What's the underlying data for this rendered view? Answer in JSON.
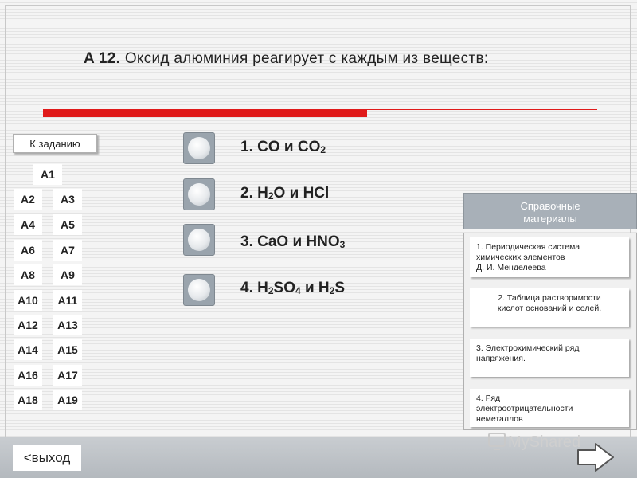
{
  "question": {
    "number": "A 12.",
    "text": "Оксид алюминия реагирует с каждым из веществ:"
  },
  "to_task_label": "К заданию",
  "task_nav": [
    "A1",
    "A2",
    "A3",
    "A4",
    "A5",
    "A6",
    "A7",
    "A8",
    "A9",
    "A10",
    "A11",
    "A12",
    "A13",
    "A14",
    "A15",
    "A16",
    "A17",
    "A18",
    "A19"
  ],
  "answers": [
    {
      "prefix": "1. CO и CO",
      "sub": "2",
      "rest": ""
    },
    {
      "prefix": "2. H",
      "sub": "2",
      "rest": "O и HCl"
    },
    {
      "prefix": "3. CaO и HNO",
      "sub": "3",
      "rest": ""
    },
    {
      "p1": "4. H",
      "s1": "2",
      "p2": "SO",
      "s2": "4",
      "p3": " и H",
      "s3": "2",
      "p4": "S"
    }
  ],
  "reference": {
    "header_line1": "Справочные",
    "header_line2": "материалы",
    "items": [
      {
        "lines": [
          "1. Периодическая система",
          "химических элементов",
          "Д. И. Менделеева"
        ]
      },
      {
        "lines": [
          "2. Таблица растворимости",
          "кислот оснований и солей."
        ]
      },
      {
        "lines": [
          "3. Электрохимический ряд",
          "напряжения."
        ]
      },
      {
        "lines": [
          "4. Ряд",
          "электроотрицательности",
          "неметаллов"
        ]
      }
    ]
  },
  "exit_label": "<выход",
  "watermark_text": "MyShared",
  "colors": {
    "accent_red": "#e01a1a",
    "panel_gray": "#a8b0b8"
  }
}
